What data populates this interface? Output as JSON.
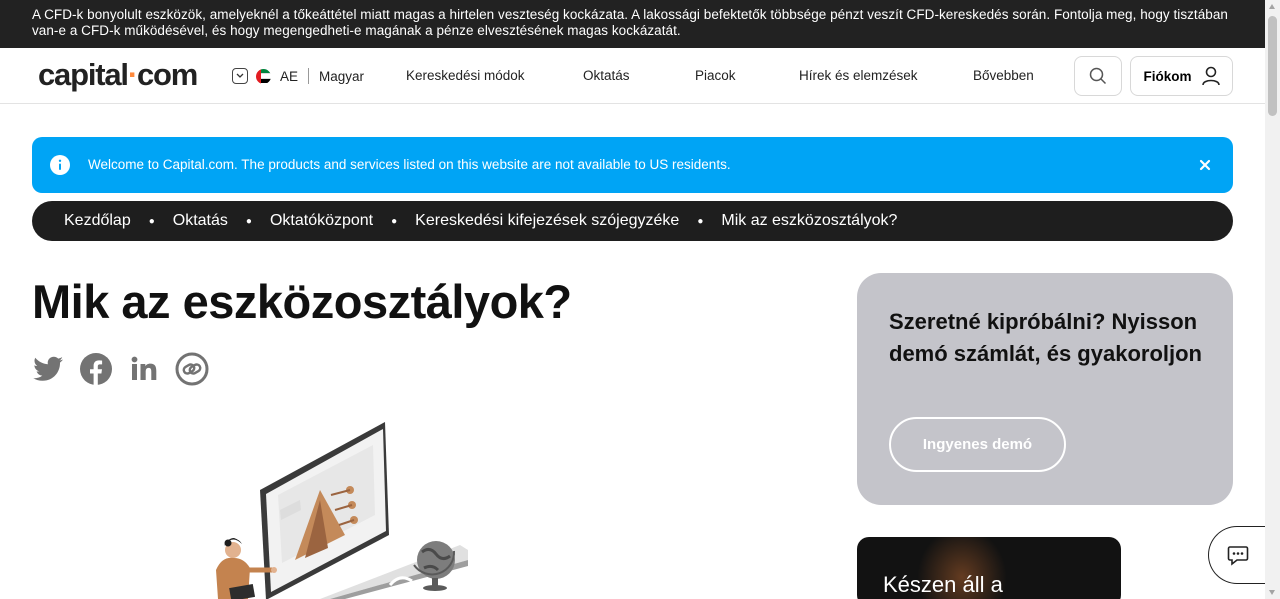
{
  "risk_warning": "A CFD-k bonyolult eszközök, amelyeknél a tőkeáttétel miatt magas a hirtelen veszteség kockázata. A lakossági befektetők többsége pénzt veszít CFD-kereskedés során. Fontolja meg, hogy tisztában van-e a CFD-k működésével, és hogy megengedheti-e magának a pénze elvesztésének magas kockázatát.",
  "header": {
    "logo_main": "capital",
    "logo_dot": "·",
    "logo_tld": "com",
    "region_code": "AE",
    "language": "Magyar",
    "nav": [
      "Kereskedési módok",
      "Oktatás",
      "Piacok",
      "Hírek és elemzések",
      "Bővebben"
    ],
    "account_label": "Fiókom"
  },
  "us_banner": {
    "text": "Welcome to Capital.com. The products and services listed on this website are not available to US residents."
  },
  "breadcrumb": [
    "Kezdőlap",
    "Oktatás",
    "Oktatóközpont",
    "Kereskedési kifejezések szójegyzéke",
    "Mik az eszközosztályok?"
  ],
  "page_title": "Mik az eszközosztályok?",
  "share_icons": [
    "twitter-icon",
    "facebook-icon",
    "linkedin-icon",
    "copy-link-icon"
  ],
  "promo": {
    "text": "Szeretné kipróbálni? Nyisson demó számlát, és gyakoroljon",
    "button": "Ingyenes demó"
  },
  "dark_card": {
    "text": "Készen áll a"
  },
  "colors": {
    "accent_orange": "#ff8a3d",
    "banner_blue": "#00a4f5",
    "dark": "#1e1e1e",
    "promo_grey": "#c4c4ca"
  }
}
